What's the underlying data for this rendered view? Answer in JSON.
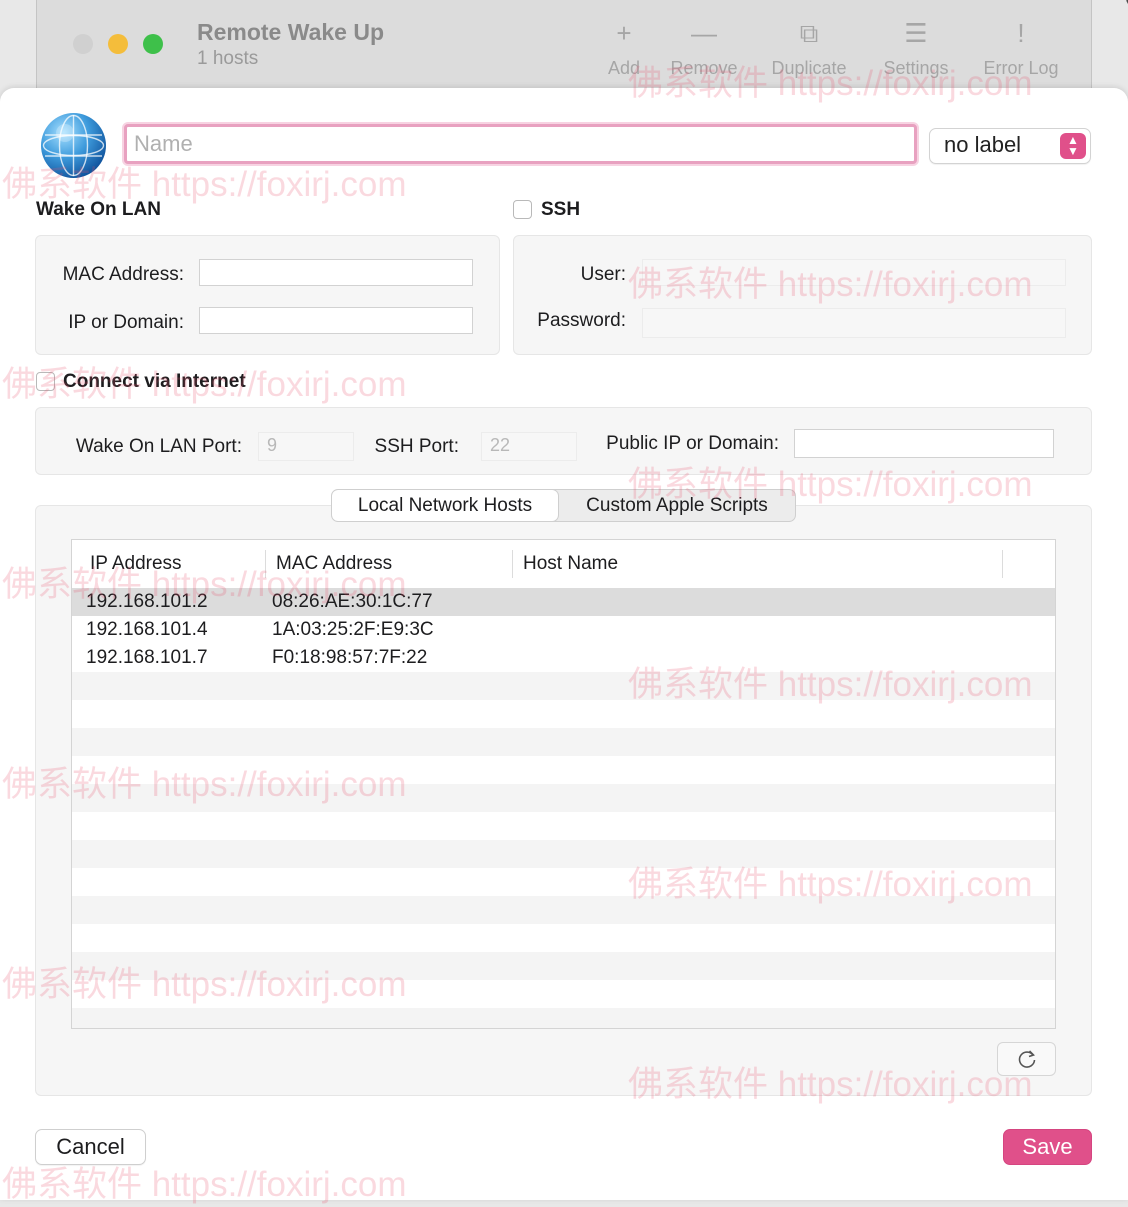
{
  "background_window": {
    "title": "Remote Wake Up",
    "subtitle": "1 hosts",
    "toolbar": [
      {
        "icon": "plus-icon",
        "glyph": "+",
        "label": "Add"
      },
      {
        "icon": "minus-icon",
        "glyph": "—",
        "label": "Remove"
      },
      {
        "icon": "duplicate-icon",
        "glyph": "⧉",
        "label": "Duplicate"
      },
      {
        "icon": "sliders-icon",
        "glyph": "☰",
        "label": "Settings"
      },
      {
        "icon": "exclamation-bubble-icon",
        "glyph": "!",
        "label": "Error Log"
      }
    ]
  },
  "header": {
    "name_placeholder": "Name",
    "name_value": "",
    "label_select": "no label"
  },
  "wake_on_lan": {
    "title": "Wake On LAN",
    "mac_label": "MAC Address:",
    "mac_value": "",
    "ip_label": "IP or Domain:",
    "ip_value": ""
  },
  "ssh": {
    "title": "SSH",
    "checked": false,
    "user_label": "User:",
    "user_value": "",
    "password_label": "Password:",
    "password_value": ""
  },
  "internet": {
    "title": "Connect via Internet",
    "checked": false,
    "wol_port_label": "Wake On LAN Port:",
    "wol_port_value": "9",
    "ssh_port_label": "SSH Port:",
    "ssh_port_value": "22",
    "public_ip_label": "Public IP or Domain:",
    "public_ip_value": ""
  },
  "tabs": [
    {
      "label": "Local Network Hosts",
      "active": true
    },
    {
      "label": "Custom Apple Scripts",
      "active": false
    }
  ],
  "table": {
    "columns": [
      "IP Address",
      "MAC Address",
      "Host Name"
    ],
    "rows": [
      {
        "ip": "192.168.101.2",
        "mac": "08:26:AE:30:1C:77",
        "host": "",
        "selected": true
      },
      {
        "ip": "192.168.101.4",
        "mac": "1A:03:25:2F:E9:3C",
        "host": "",
        "selected": false
      },
      {
        "ip": "192.168.101.7",
        "mac": "F0:18:98:57:7F:22",
        "host": "",
        "selected": false
      }
    ]
  },
  "buttons": {
    "cancel": "Cancel",
    "save": "Save",
    "refresh_icon": "refresh-icon"
  },
  "watermark": "佛系软件 https://foxirj.com",
  "colors": {
    "accent": "#e0508a",
    "focus_ring": "#e8a1c0"
  }
}
